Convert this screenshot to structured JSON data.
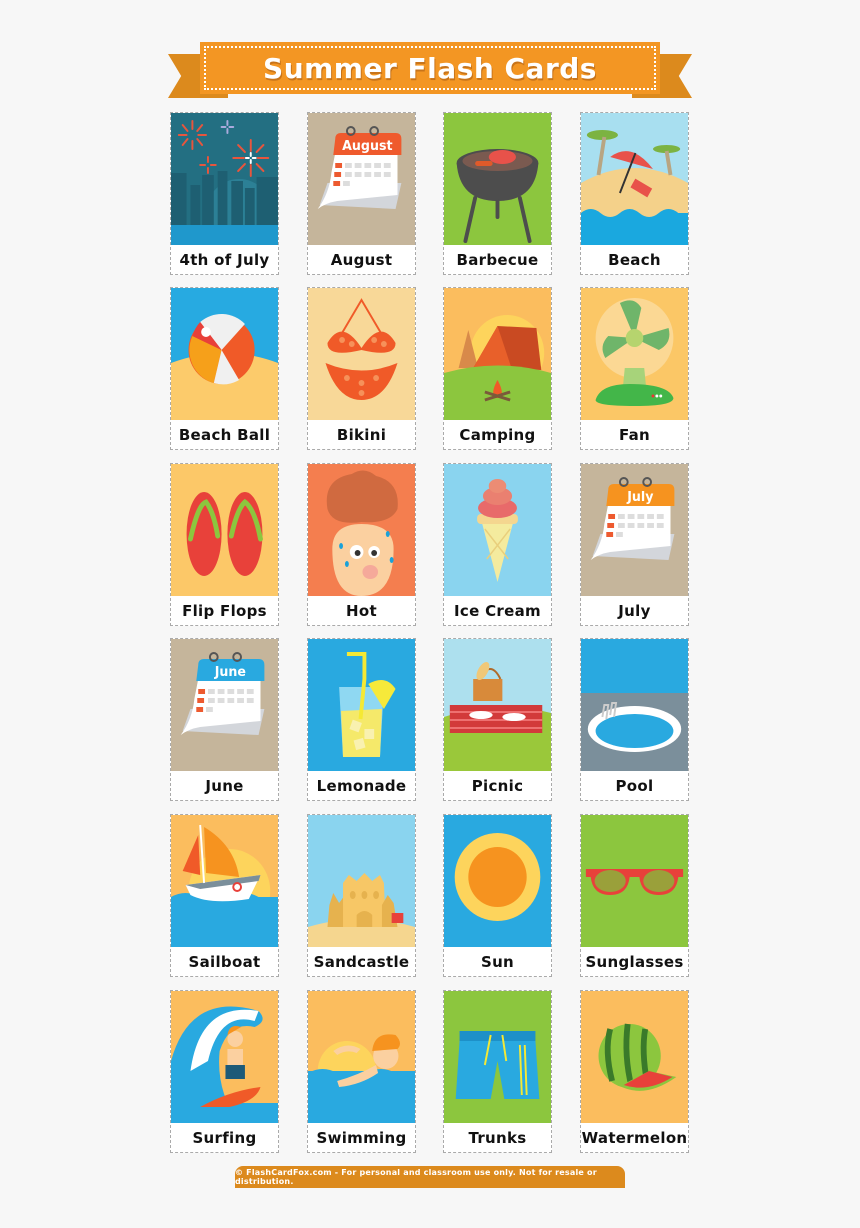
{
  "title": "Summer Flash Cards",
  "footer": "© FlashCardFox.com - For personal and classroom use only. Not for resale or distribution.",
  "colors": {
    "banner": "#f39623",
    "banner_tail": "#dc8a1d",
    "background": "#f7f7f7"
  },
  "cards": [
    {
      "label": "4th of July",
      "icon": "fireworks-icon",
      "bg": "#236f82"
    },
    {
      "label": "August",
      "icon": "calendar-august-icon",
      "bg": "#c5b59b"
    },
    {
      "label": "Barbecue",
      "icon": "grill-icon",
      "bg": "#8cc63e"
    },
    {
      "label": "Beach",
      "icon": "beach-umbrella-icon",
      "bg": "#a8dff0"
    },
    {
      "label": "Beach Ball",
      "icon": "beach-ball-icon",
      "bg": "#27aae1"
    },
    {
      "label": "Bikini",
      "icon": "bikini-icon",
      "bg": "#f8d898"
    },
    {
      "label": "Camping",
      "icon": "tent-icon",
      "bg": "#fbbd5e"
    },
    {
      "label": "Fan",
      "icon": "fan-icon",
      "bg": "#fbc766"
    },
    {
      "label": "Flip Flops",
      "icon": "flip-flops-icon",
      "bg": "#fcc868"
    },
    {
      "label": "Hot",
      "icon": "sweating-face-icon",
      "bg": "#f47e4f"
    },
    {
      "label": "Ice Cream",
      "icon": "ice-cream-icon",
      "bg": "#8ad4ef"
    },
    {
      "label": "July",
      "icon": "calendar-july-icon",
      "bg": "#c5b59b"
    },
    {
      "label": "June",
      "icon": "calendar-june-icon",
      "bg": "#c5b59b"
    },
    {
      "label": "Lemonade",
      "icon": "lemonade-icon",
      "bg": "#29a9e0"
    },
    {
      "label": "Picnic",
      "icon": "picnic-basket-icon",
      "bg": "#ade0ee"
    },
    {
      "label": "Pool",
      "icon": "pool-icon",
      "bg": "#7b8f9b"
    },
    {
      "label": "Sailboat",
      "icon": "sailboat-icon",
      "bg": "#fbbd5e"
    },
    {
      "label": "Sandcastle",
      "icon": "sandcastle-icon",
      "bg": "#8ad4ef"
    },
    {
      "label": "Sun",
      "icon": "sun-icon",
      "bg": "#29a9e0"
    },
    {
      "label": "Sunglasses",
      "icon": "sunglasses-icon",
      "bg": "#8cc63e"
    },
    {
      "label": "Surfing",
      "icon": "surfer-icon",
      "bg": "#fbbd5e"
    },
    {
      "label": "Swimming",
      "icon": "swimmer-icon",
      "bg": "#fbbd5e"
    },
    {
      "label": "Trunks",
      "icon": "swim-trunks-icon",
      "bg": "#8cc63e"
    },
    {
      "label": "Watermelon",
      "icon": "watermelon-icon",
      "bg": "#fbbd5e"
    }
  ]
}
